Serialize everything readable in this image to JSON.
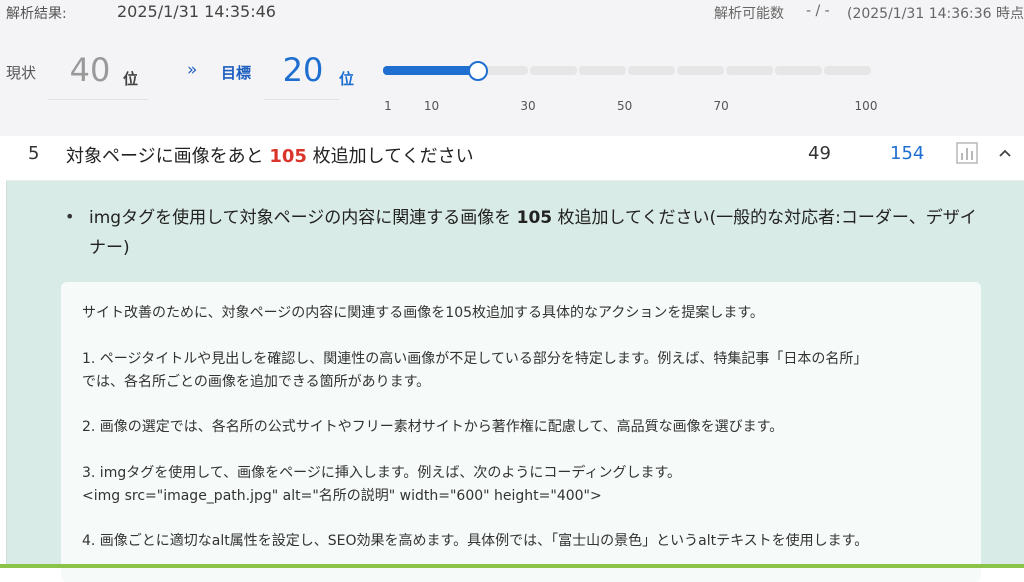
{
  "header": {
    "analysis_label": "解析結果:",
    "analysis_time": "2025/1/31 14:35:46",
    "available_label": "解析可能数",
    "available_value": "- / -",
    "available_time": "(2025/1/31 14:36:36 時点"
  },
  "ranking": {
    "current_label": "現状",
    "current_value": "40",
    "unit": "位",
    "arrow": "»",
    "target_label": "目標",
    "target_value": "20"
  },
  "slider": {
    "value": 20,
    "min": 1,
    "max": 100,
    "ticks": [
      "1",
      "10",
      "30",
      "50",
      "70",
      "100"
    ],
    "colors": {
      "fill": "#1f6fd1",
      "track": "#e6e6e6"
    }
  },
  "row": {
    "number": "5",
    "title_prefix": "対象ページに画像をあと ",
    "title_highlight": "105",
    "title_suffix": " 枚追加してください",
    "score": "49",
    "link_value": "154",
    "chart_icon": "bar-chart-icon",
    "collapse_icon": "chevron-up-icon",
    "highlight_color": "#d9352b"
  },
  "detail": {
    "bullet": "•",
    "text_prefix": "imgタグを使用して対象ページの内容に関連する画像を ",
    "text_bold": "105",
    "text_suffix": " 枚追加してください(一般的な対応者:コーダー、デザイナー)",
    "suggestion": {
      "intro": "サイト改善のために、対象ページの内容に関連する画像を105枚追加する具体的なアクションを提案します。",
      "step1_line1": "1. ページタイトルや見出しを確認し、関連性の高い画像が不足している部分を特定します。例えば、特集記事「日本の名所」",
      "step1_line2": "では、各名所ごとの画像を追加できる箇所があります。",
      "step2": "2. 画像の選定では、各名所の公式サイトやフリー素材サイトから著作権に配慮して、高品質な画像を選びます。",
      "step3_line1": "3. imgタグを使用して、画像をページに挿入します。例えば、次のようにコーディングします。",
      "step3_code": "<img src=\"image_path.jpg\" alt=\"名所の説明\" width=\"600\" height=\"400\">",
      "step4": "4. 画像ごとに適切なalt属性を設定し、SEO効果を高めます。具体例では、「富士山の景色」というaltテキストを使用します。"
    }
  }
}
